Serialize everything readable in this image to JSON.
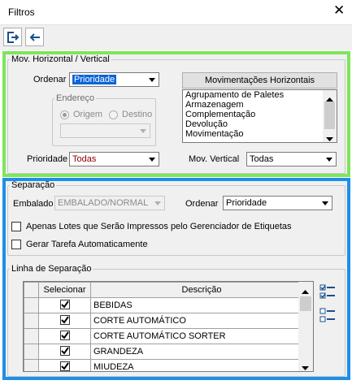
{
  "window": {
    "title": "Filtros"
  },
  "icons": {
    "close": "close-icon",
    "apply": "apply-filter-icon",
    "back": "back-arrow-icon",
    "select_all": "check-list-icon",
    "deselect_all": "uncheck-list-icon"
  },
  "colors": {
    "green_frame": "#7de65a",
    "blue_frame": "#1d8fe8",
    "selection": "#0a64d8",
    "red_value": "#8b0000"
  },
  "mov": {
    "legend": "Mov. Horizontal / Vertical",
    "ordenar_label": "Ordenar",
    "ordenar_value": "Prioridade",
    "endereco": {
      "legend": "Endereço",
      "origem_label": "Origem",
      "destino_label": "Destino",
      "selected": "Origem",
      "combo_value": ""
    },
    "prioridade_label": "Prioridade",
    "prioridade_value": "Todas",
    "horizontal_button": "Movimentações Horizontais",
    "horizontal_items": [
      "Agrupamento de Paletes",
      "Armazenagem",
      "Complementação",
      "Devolução",
      "Movimentação"
    ],
    "vertical_label": "Mov. Vertical",
    "vertical_value": "Todas"
  },
  "sep": {
    "legend": "Separação",
    "embalado_label": "Embalado",
    "embalado_value": "EMBALADO/NORMAL",
    "ordenar_label": "Ordenar",
    "ordenar_value": "Prioridade",
    "check1_label": "Apenas Lotes que Serão Impressos pelo Gerenciador de Etiquetas",
    "check1_checked": false,
    "check2_label": "Gerar Tarefa Automaticamente",
    "check2_checked": false
  },
  "linha": {
    "legend": "Linha de Separação",
    "columns": [
      "Selecionar",
      "Descrição"
    ],
    "rows": [
      {
        "selected": true,
        "descricao": "BEBIDAS"
      },
      {
        "selected": true,
        "descricao": "CORTE AUTOMÁTICO"
      },
      {
        "selected": true,
        "descricao": "CORTE AUTOMÁTICO SORTER"
      },
      {
        "selected": true,
        "descricao": "GRANDEZA"
      },
      {
        "selected": true,
        "descricao": "MIUDEZA"
      }
    ]
  }
}
